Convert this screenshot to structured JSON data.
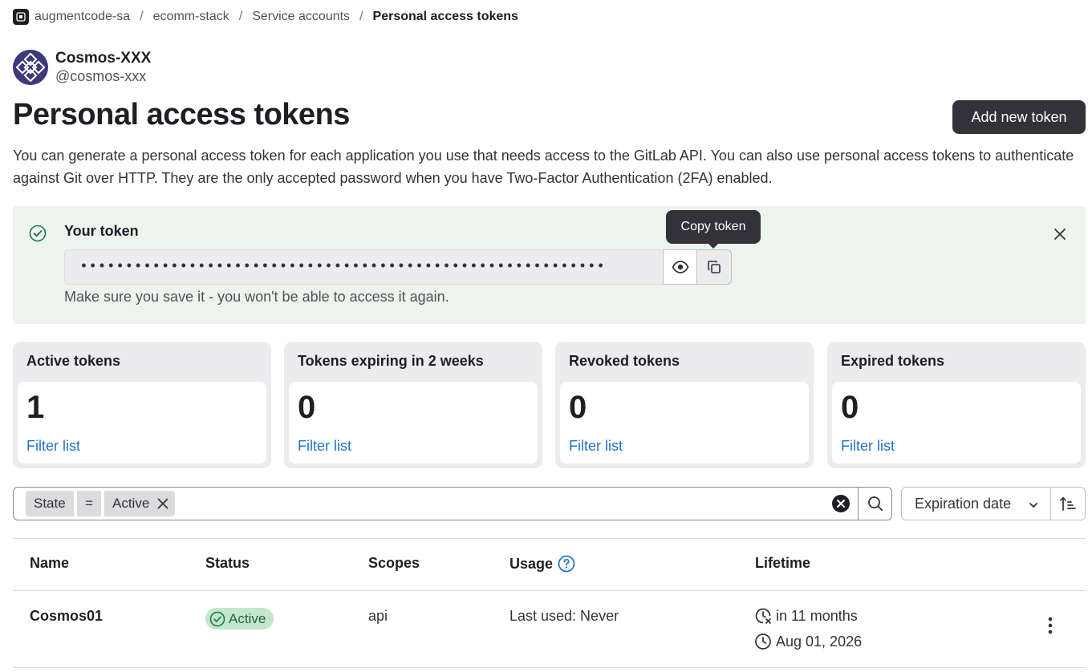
{
  "breadcrumb": {
    "items": [
      "augmentcode-sa",
      "ecomm-stack",
      "Service accounts"
    ],
    "current": "Personal access tokens"
  },
  "account": {
    "name": "Cosmos-XXX",
    "handle": "@cosmos-xxx"
  },
  "page": {
    "title": "Personal access tokens",
    "add_button": "Add new token",
    "description": "You can generate a personal access token for each application you use that needs access to the GitLab API. You can also use personal access tokens to authenticate against Git over HTTP. They are the only accepted password when you have Two-Factor Authentication (2FA) enabled."
  },
  "alert": {
    "title": "Your token",
    "token_masked": "••••••••••••••••••••••••••••••••••••••••••••••••••••••••••",
    "note": "Make sure you save it - you won't be able to access it again.",
    "tooltip": "Copy token"
  },
  "stats": [
    {
      "title": "Active tokens",
      "value": "1",
      "link": "Filter list"
    },
    {
      "title": "Tokens expiring in 2 weeks",
      "value": "0",
      "link": "Filter list"
    },
    {
      "title": "Revoked tokens",
      "value": "0",
      "link": "Filter list"
    },
    {
      "title": "Expired tokens",
      "value": "0",
      "link": "Filter list"
    }
  ],
  "filter": {
    "field": "State",
    "operator": "=",
    "value": "Active"
  },
  "sort": {
    "label": "Expiration date"
  },
  "table": {
    "headers": [
      "Name",
      "Status",
      "Scopes",
      "Usage",
      "Lifetime"
    ],
    "rows": [
      {
        "name": "Cosmos01",
        "status": "Active",
        "scopes": "api",
        "usage": "Last used: Never",
        "expires_in": "in 11 months",
        "expires_on": "Aug 01, 2026"
      }
    ]
  },
  "colors": {
    "accent": "#1f75cb",
    "success_bg": "#ecf4ee",
    "badge_bg": "#c3e6cd",
    "badge_text": "#24663b",
    "dark_button": "#333238"
  }
}
